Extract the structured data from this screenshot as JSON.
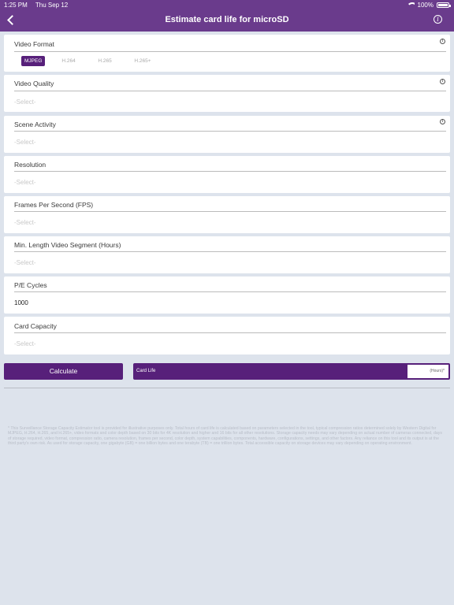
{
  "status_bar": {
    "time": "1:25 PM",
    "date": "Thu Sep 12",
    "battery": "100%"
  },
  "header": {
    "title": "Estimate card life for microSD",
    "info_glyph": "i"
  },
  "fields": {
    "video_format": {
      "label": "Video Format",
      "options": [
        "MJPEG",
        "H.264",
        "H.265",
        "H.265+"
      ],
      "selected": "MJPEG"
    },
    "video_quality": {
      "label": "Video Quality",
      "value": "-Select-"
    },
    "scene_activity": {
      "label": "Scene Activity",
      "value": "-Select-"
    },
    "resolution": {
      "label": "Resolution",
      "value": "-Select-"
    },
    "fps": {
      "label": "Frames Per Second (FPS)",
      "value": "-Select-"
    },
    "min_length": {
      "label": "Min. Length Video Segment (Hours)",
      "value": "-Select-"
    },
    "pe_cycles": {
      "label": "P/E Cycles",
      "value": "1000"
    },
    "card_capacity": {
      "label": "Card Capacity",
      "value": "-Select-"
    }
  },
  "actions": {
    "calculate_label": "Calculate",
    "result_label": "Card Life",
    "result_unit": "(Hours)*"
  },
  "disclaimer": "* This Surveillance Storage Capacity Estimator tool is provided for illustrative purposes only. Total hours of card life is calculated based on parameters selected in the tool, typical compression ratios determined solely by Western Digital for MJPEG, H.264, H.265, and H.265+, video formats and color depth based on 30 bits for 4K resolution and higher and 16 bits for all other resolutions. Storage capacity needs may vary depending on actual number of cameras connected, days of storage required, video format, compression ratio, camera resolution, frames per second, color depth, system capabilities, components, hardware, configurations, settings, and other factors. Any reliance on this tool and its output is at the third party's own risk. As used for storage capacity, one gigabyte (GB) = one billion bytes and one terabyte (TB) = one trillion bytes. Total accessible capacity on storage devices may vary depending on operating environment.",
  "colors": {
    "header": "#6a3b8c",
    "accent": "#57207a",
    "background": "#dde3ec"
  }
}
